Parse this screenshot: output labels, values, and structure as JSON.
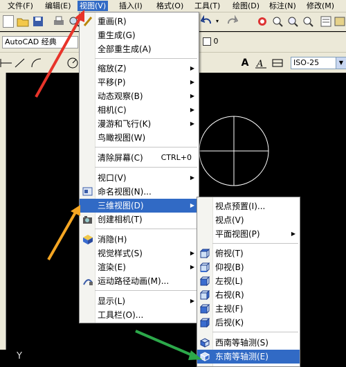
{
  "menubar": {
    "items": [
      {
        "label": "文件(F)"
      },
      {
        "label": "编辑(E)"
      },
      {
        "label": "视图(V)"
      },
      {
        "label": "插入(I)"
      },
      {
        "label": "格式(O)"
      },
      {
        "label": "工具(T)"
      },
      {
        "label": "绘图(D)"
      },
      {
        "label": "标注(N)"
      },
      {
        "label": "修改(M)"
      }
    ]
  },
  "toolbar": {
    "workspace": "AutoCAD 经典",
    "layer_value": "0",
    "dim_style": "ISO-25"
  },
  "view_menu": {
    "items": [
      {
        "label": "重画(R)"
      },
      {
        "label": "重生成(G)"
      },
      {
        "label": "全部重生成(A)"
      },
      {
        "label": "缩放(Z)"
      },
      {
        "label": "平移(P)"
      },
      {
        "label": "动态观察(B)"
      },
      {
        "label": "相机(C)"
      },
      {
        "label": "漫游和飞行(K)"
      },
      {
        "label": "鸟瞰视图(W)"
      },
      {
        "label": "清除屏幕(C)",
        "shortcut": "CTRL+0"
      },
      {
        "label": "视口(V)"
      },
      {
        "label": "命名视图(N)..."
      },
      {
        "label": "三维视图(D)"
      },
      {
        "label": "创建相机(T)"
      },
      {
        "label": "消隐(H)"
      },
      {
        "label": "视觉样式(S)"
      },
      {
        "label": "渲染(E)"
      },
      {
        "label": "运动路径动画(M)..."
      },
      {
        "label": "显示(L)"
      },
      {
        "label": "工具栏(O)..."
      }
    ]
  },
  "view3d_menu": {
    "items": [
      {
        "label": "视点预置(I)..."
      },
      {
        "label": "视点(V)"
      },
      {
        "label": "平面视图(P)"
      },
      {
        "label": "俯视(T)"
      },
      {
        "label": "仰视(B)"
      },
      {
        "label": "左视(L)"
      },
      {
        "label": "右视(R)"
      },
      {
        "label": "主视(F)"
      },
      {
        "label": "后视(K)"
      },
      {
        "label": "西南等轴测(S)"
      },
      {
        "label": "东南等轴测(E)"
      }
    ]
  },
  "canvas": {
    "y_axis_label": "Y"
  },
  "colors": {
    "menu_highlight": "#316ac5",
    "arrow_red": "#e8342a",
    "arrow_orange": "#f5a623",
    "arrow_green": "#2ca84a"
  }
}
